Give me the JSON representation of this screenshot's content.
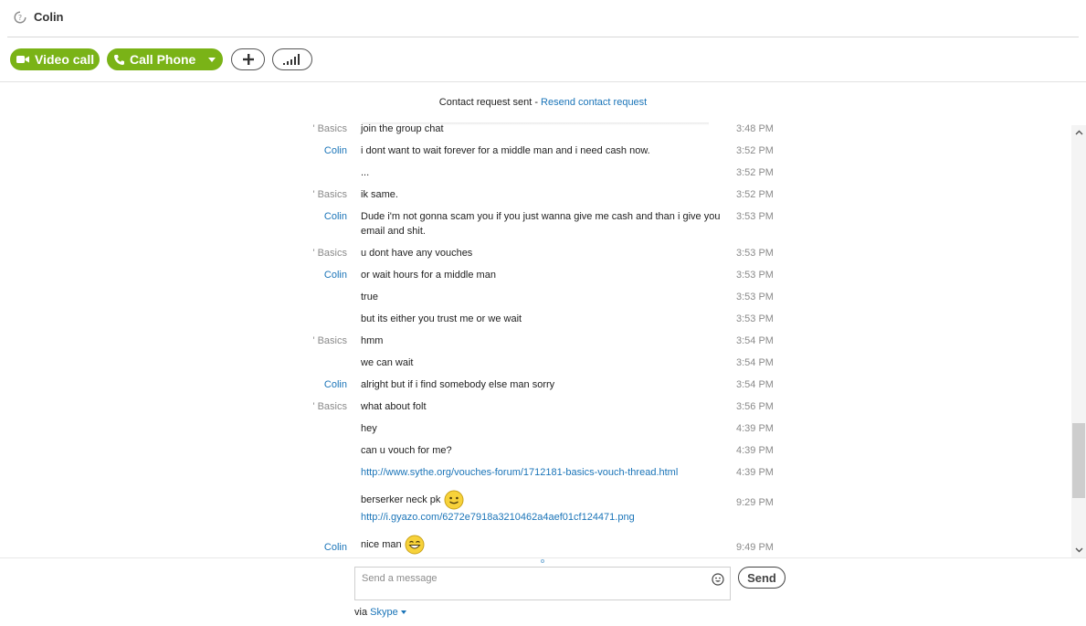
{
  "header": {
    "contact_name": "Colin"
  },
  "toolbar": {
    "video_call_label": "Video call",
    "call_phone_label": "Call Phone"
  },
  "request": {
    "text": "Contact request sent - ",
    "link": "Resend contact request"
  },
  "messages": [
    {
      "sender": "' Basics",
      "text": "join the group chat",
      "time": "3:48 PM"
    },
    {
      "sender": "Colin",
      "text": "i dont want to wait forever for a middle man and i need cash now.",
      "time": "3:52 PM"
    },
    {
      "sender": "",
      "text": "...",
      "time": "3:52 PM"
    },
    {
      "sender": "' Basics",
      "text": "ik same.",
      "time": "3:52 PM"
    },
    {
      "sender": "Colin",
      "text": "Dude i'm not gonna scam you if you just wanna give me cash and than i give you email and shit.",
      "time": "3:53 PM"
    },
    {
      "sender": "' Basics",
      "text": "u dont have any vouches",
      "time": "3:53 PM"
    },
    {
      "sender": "Colin",
      "text": "or wait hours for a middle man",
      "time": "3:53 PM"
    },
    {
      "sender": "",
      "text": "true",
      "time": "3:53 PM"
    },
    {
      "sender": "",
      "text": "but its either you trust me or we wait",
      "time": "3:53 PM"
    },
    {
      "sender": "' Basics",
      "text": "hmm",
      "time": "3:54 PM"
    },
    {
      "sender": "",
      "text": "we can wait",
      "time": "3:54 PM"
    },
    {
      "sender": "Colin",
      "text": "alright but if i find somebody else man sorry",
      "time": "3:54 PM"
    },
    {
      "sender": "' Basics",
      "text": "what about folt",
      "time": "3:56 PM"
    },
    {
      "sender": "",
      "text": "hey",
      "time": "4:39 PM"
    },
    {
      "sender": "",
      "text": "can u vouch for me?",
      "time": "4:39 PM"
    },
    {
      "sender": "",
      "text": "",
      "link": "http://www.sythe.org/vouches-forum/1712181-basics-vouch-thread.html",
      "time": "4:39 PM"
    },
    {
      "sender": "",
      "text": "berserker neck pk",
      "emoji": "smile-emoji",
      "link": "http://i.gyazo.com/6272e7918a3210462a4aef01cf124471.png",
      "time": "9:29 PM"
    },
    {
      "sender": "Colin",
      "text": "nice man",
      "emoji": "laugh-emoji",
      "time": "9:49 PM"
    }
  ],
  "composer": {
    "placeholder": "Send a message",
    "send_label": "Send"
  },
  "footer": {
    "via_label": "via ",
    "service": "Skype"
  },
  "colors": {
    "accent_green": "#7ab317",
    "link_blue": "#1a74b8",
    "muted_gray": "#8a8a8a"
  },
  "icons": [
    "skype-status-icon",
    "camera-icon",
    "phone-icon",
    "chevron-down-icon",
    "plus-icon",
    "signal-bars-icon",
    "smiley-icon",
    "scroll-up-icon",
    "scroll-down-icon"
  ]
}
